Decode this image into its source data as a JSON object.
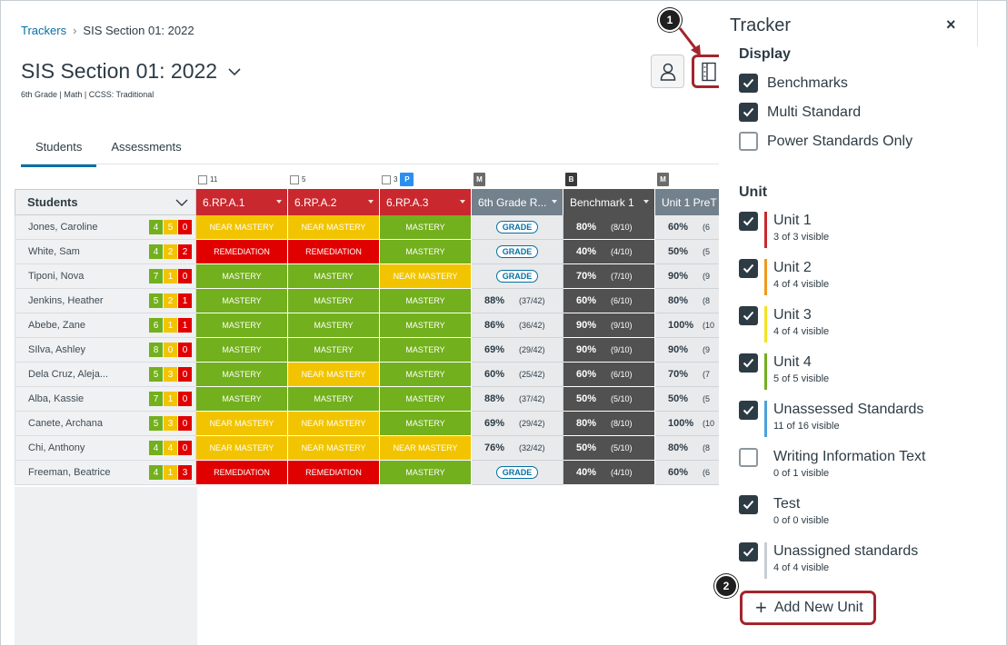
{
  "breadcrumb": {
    "root": "Trackers",
    "current": "SIS Section 01: 2022"
  },
  "page": {
    "title": "SIS Section 01: 2022",
    "subtitle": "6th Grade  |  Math  |  CCSS: Traditional"
  },
  "tabs": [
    {
      "label": "Students"
    },
    {
      "label": "Assessments"
    }
  ],
  "callouts": {
    "one": "1",
    "two": "2"
  },
  "grid": {
    "students_header": "Students",
    "top_badges": {
      "col1": "11",
      "col2": "5",
      "col3": "3",
      "col3_badge": "P",
      "col4": "M",
      "col5": "B",
      "col6": "M"
    },
    "columns": [
      "6.RP.A.1",
      "6.RP.A.2",
      "6.RP.A.3",
      "6th Grade R...",
      "Benchmark 1",
      "Unit 1 PreT"
    ],
    "rows": [
      {
        "name": "Jones, Caroline",
        "c": [
          "4",
          "5",
          "0"
        ],
        "s1": "NEAR MASTERY",
        "s2": "NEAR MASTERY",
        "s3": "MASTERY",
        "r_pct": "",
        "r_frac": "",
        "b_pct": "80%",
        "b_frac": "(8/10)",
        "u_pct": "60%",
        "u_frac": "(6"
      },
      {
        "name": "White, Sam",
        "c": [
          "4",
          "2",
          "2"
        ],
        "s1": "REMEDIATION",
        "s2": "REMEDIATION",
        "s3": "MASTERY",
        "r_pct": "",
        "r_frac": "",
        "b_pct": "40%",
        "b_frac": "(4/10)",
        "u_pct": "50%",
        "u_frac": "(5"
      },
      {
        "name": "Tiponi, Nova",
        "c": [
          "7",
          "1",
          "0"
        ],
        "s1": "MASTERY",
        "s2": "MASTERY",
        "s3": "NEAR MASTERY",
        "r_pct": "",
        "r_frac": "",
        "b_pct": "70%",
        "b_frac": "(7/10)",
        "u_pct": "90%",
        "u_frac": "(9"
      },
      {
        "name": "Jenkins, Heather",
        "c": [
          "5",
          "2",
          "1"
        ],
        "s1": "MASTERY",
        "s2": "MASTERY",
        "s3": "MASTERY",
        "r_pct": "88%",
        "r_frac": "(37/42)",
        "b_pct": "60%",
        "b_frac": "(6/10)",
        "u_pct": "80%",
        "u_frac": "(8"
      },
      {
        "name": "Abebe, Zane",
        "c": [
          "6",
          "1",
          "1"
        ],
        "s1": "MASTERY",
        "s2": "MASTERY",
        "s3": "MASTERY",
        "r_pct": "86%",
        "r_frac": "(36/42)",
        "b_pct": "90%",
        "b_frac": "(9/10)",
        "u_pct": "100%",
        "u_frac": "(10"
      },
      {
        "name": "SIlva, Ashley",
        "c": [
          "8",
          "0",
          "0"
        ],
        "s1": "MASTERY",
        "s2": "MASTERY",
        "s3": "MASTERY",
        "r_pct": "69%",
        "r_frac": "(29/42)",
        "b_pct": "90%",
        "b_frac": "(9/10)",
        "u_pct": "90%",
        "u_frac": "(9"
      },
      {
        "name": "Dela Cruz, Aleja...",
        "c": [
          "5",
          "3",
          "0"
        ],
        "s1": "MASTERY",
        "s2": "NEAR MASTERY",
        "s3": "MASTERY",
        "r_pct": "60%",
        "r_frac": "(25/42)",
        "b_pct": "60%",
        "b_frac": "(6/10)",
        "u_pct": "70%",
        "u_frac": "(7"
      },
      {
        "name": "Alba, Kassie",
        "c": [
          "7",
          "1",
          "0"
        ],
        "s1": "MASTERY",
        "s2": "MASTERY",
        "s3": "MASTERY",
        "r_pct": "88%",
        "r_frac": "(37/42)",
        "b_pct": "50%",
        "b_frac": "(5/10)",
        "u_pct": "50%",
        "u_frac": "(5"
      },
      {
        "name": "Canete, Archana",
        "c": [
          "5",
          "3",
          "0"
        ],
        "s1": "NEAR MASTERY",
        "s2": "NEAR MASTERY",
        "s3": "MASTERY",
        "r_pct": "69%",
        "r_frac": "(29/42)",
        "b_pct": "80%",
        "b_frac": "(8/10)",
        "u_pct": "100%",
        "u_frac": "(10"
      },
      {
        "name": "Chi, Anthony",
        "c": [
          "4",
          "4",
          "0"
        ],
        "s1": "NEAR MASTERY",
        "s2": "NEAR MASTERY",
        "s3": "NEAR MASTERY",
        "r_pct": "76%",
        "r_frac": "(32/42)",
        "b_pct": "50%",
        "b_frac": "(5/10)",
        "u_pct": "80%",
        "u_frac": "(8"
      },
      {
        "name": "Freeman, Beatrice",
        "c": [
          "4",
          "1",
          "3"
        ],
        "s1": "REMEDIATION",
        "s2": "REMEDIATION",
        "s3": "MASTERY",
        "r_pct": "",
        "r_frac": "",
        "b_pct": "40%",
        "b_frac": "(4/10)",
        "u_pct": "60%",
        "u_frac": "(6"
      }
    ],
    "grade_label": "GRADE"
  },
  "tray": {
    "title": "Tracker",
    "close": "×",
    "display_heading": "Display",
    "display_options": [
      {
        "label": "Benchmarks",
        "checked": true
      },
      {
        "label": "Multi Standard",
        "checked": true
      },
      {
        "label": "Power Standards Only",
        "checked": false
      }
    ],
    "unit_heading": "Unit",
    "units": [
      {
        "name": "Unit 1",
        "visible": "3 of 3 visible",
        "checked": true,
        "color": "#c8282e"
      },
      {
        "name": "Unit 2",
        "visible": "4 of 4 visible",
        "checked": true,
        "color": "#f09a1a"
      },
      {
        "name": "Unit 3",
        "visible": "4 of 4 visible",
        "checked": true,
        "color": "#f4e31c"
      },
      {
        "name": "Unit 4",
        "visible": "5 of 5 visible",
        "checked": true,
        "color": "#72b01d"
      },
      {
        "name": "Unassessed Standards",
        "visible": "11 of 16 visible",
        "checked": true,
        "color": "#4aa0dc"
      },
      {
        "name": "Writing Information Text",
        "visible": "0 of 1 visible",
        "checked": false,
        "color": ""
      },
      {
        "name": "Test",
        "visible": "0 of 0 visible",
        "checked": true,
        "color": ""
      },
      {
        "name": "Unassigned standards",
        "visible": "4 of 4 visible",
        "checked": true,
        "color": "#c7cdd1"
      }
    ],
    "add_unit": "Add New Unit"
  },
  "colors": {
    "mastery": "#72b01d",
    "near": "#f2c400",
    "remediation": "#e10000",
    "header_red": "#c8282e",
    "header_gray": "#73818c",
    "header_dark": "#515151",
    "highlight": "#a3252d",
    "link": "#0770a3"
  }
}
